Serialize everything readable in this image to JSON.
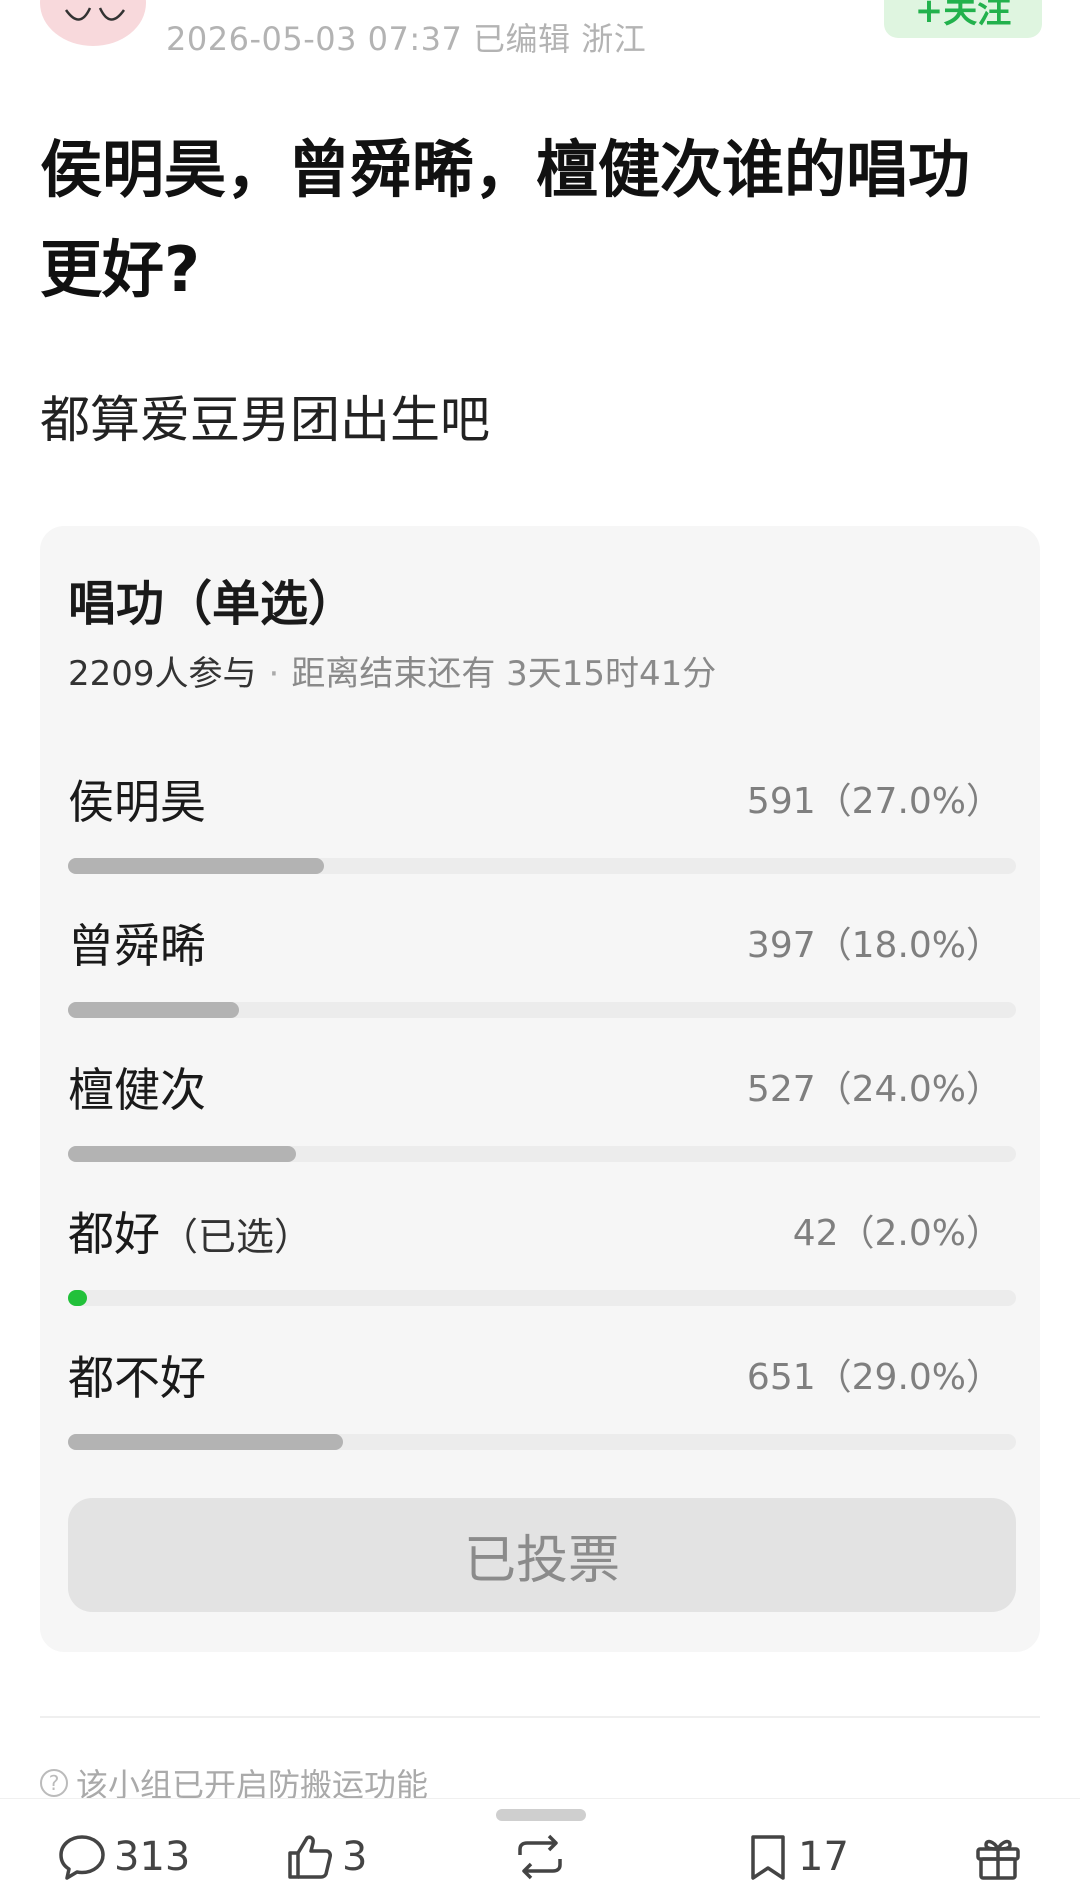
{
  "post": {
    "meta": "2026-05-03 07:37 已编辑 浙江",
    "follow_label": "+关注",
    "title": "侯明昊，曾舜晞，檀健次谁的唱功更好?",
    "body": "都算爱豆男团出生吧"
  },
  "poll": {
    "title": "唱功（单选）",
    "participants": "2209人参与",
    "separator": "·",
    "time_left": "距离结束还有 3天15时41分",
    "options": [
      {
        "label": "侯明昊",
        "selected_tag": "",
        "count": "591（27.0%）",
        "percent": 27.0,
        "selected": false
      },
      {
        "label": "曾舜晞",
        "selected_tag": "",
        "count": "397（18.0%）",
        "percent": 18.0,
        "selected": false
      },
      {
        "label": "檀健次",
        "selected_tag": "",
        "count": "527（24.0%）",
        "percent": 24.0,
        "selected": false
      },
      {
        "label": "都好",
        "selected_tag": "（已选）",
        "count": "42（2.0%）",
        "percent": 2.0,
        "selected": true
      },
      {
        "label": "都不好",
        "selected_tag": "",
        "count": "651（29.0%）",
        "percent": 29.0,
        "selected": false
      }
    ],
    "voted_label": "已投票",
    "colors": {
      "selected_bar": "#22c13a",
      "bar": "#b3b3b3"
    }
  },
  "notice": {
    "icon": "question-circle-icon",
    "text": "该小组已开启防搬运功能"
  },
  "bottom_bar": {
    "comments": "313",
    "likes": "3",
    "reposts": "",
    "bookmarks": "17"
  }
}
